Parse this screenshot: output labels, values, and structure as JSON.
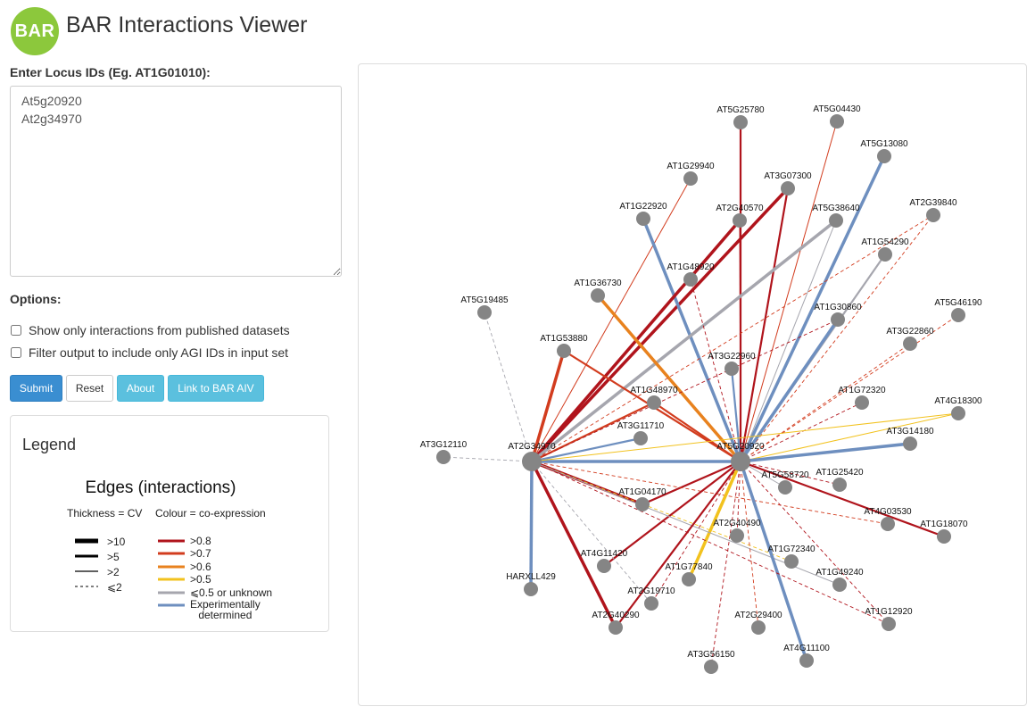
{
  "header": {
    "logo_text": "BAR",
    "title": "BAR Interactions Viewer"
  },
  "form": {
    "locus_label": "Enter Locus IDs (Eg. AT1G01010):",
    "locus_value": "At5g20920\nAt2g34970",
    "options_label": "Options:",
    "option_published": "Show only interactions from published datasets",
    "option_filter": "Filter output to include only AGI IDs in input set"
  },
  "buttons": {
    "submit": "Submit",
    "reset": "Reset",
    "about": "About",
    "link": "Link to BAR AIV"
  },
  "legend": {
    "title": "Legend",
    "edges_title": "Edges (interactions)",
    "thickness_header": "Thickness = CV",
    "colour_header": "Colour = co-expression",
    "thickness": [
      ">10",
      ">5",
      ">2",
      "⩽2"
    ],
    "colour": [
      {
        "label": ">0.8",
        "color": "#b0141c"
      },
      {
        "label": ">0.7",
        "color": "#d23c1e"
      },
      {
        "label": ">0.6",
        "color": "#e8821e"
      },
      {
        "label": ">0.5",
        "color": "#f2c21e"
      },
      {
        "label": "⩽0.5 or unknown",
        "color": "#a6a6ae"
      },
      {
        "label": "Experimentally\ndetermined",
        "color": "#6e8fbf"
      }
    ]
  },
  "graph": {
    "nodes": [
      {
        "id": "AT2G34970",
        "label": "AT2G34970",
        "hub": true
      },
      {
        "id": "AT5G20920",
        "label": "AT5G20920",
        "hub": true
      },
      {
        "id": "AT5G25780",
        "label": "AT5G25780"
      },
      {
        "id": "AT5G04430",
        "label": "AT5G04430"
      },
      {
        "id": "AT5G13080",
        "label": "AT5G13080"
      },
      {
        "id": "AT1G29940",
        "label": "AT1G29940"
      },
      {
        "id": "AT3G07300",
        "label": "AT3G07300"
      },
      {
        "id": "AT1G22920",
        "label": "AT1G22920"
      },
      {
        "id": "AT2G40570",
        "label": "AT2G40570"
      },
      {
        "id": "AT5G38640",
        "label": "AT5G38640"
      },
      {
        "id": "AT2G39840",
        "label": "AT2G39840"
      },
      {
        "id": "AT1G54290",
        "label": "AT1G54290"
      },
      {
        "id": "AT1G48920",
        "label": "AT1G48920"
      },
      {
        "id": "AT1G36730",
        "label": "AT1G36730"
      },
      {
        "id": "AT5G19485",
        "label": "AT5G19485"
      },
      {
        "id": "AT1G30860",
        "label": "AT1G30860"
      },
      {
        "id": "AT5G46190",
        "label": "AT5G46190"
      },
      {
        "id": "AT1G53880",
        "label": "AT1G53880"
      },
      {
        "id": "AT3G22860",
        "label": "AT3G22860"
      },
      {
        "id": "AT3G22960",
        "label": "AT3G22960"
      },
      {
        "id": "AT1G48970",
        "label": "AT1G48970"
      },
      {
        "id": "AT1G72320",
        "label": "AT1G72320"
      },
      {
        "id": "AT4G18300",
        "label": "AT4G18300"
      },
      {
        "id": "AT3G11710",
        "label": "AT3G11710"
      },
      {
        "id": "AT3G14180",
        "label": "AT3G14180"
      },
      {
        "id": "AT3G12110",
        "label": "AT3G12110"
      },
      {
        "id": "AT5G58720",
        "label": "AT5G58720"
      },
      {
        "id": "AT1G25420",
        "label": "AT1G25420"
      },
      {
        "id": "AT1G04170",
        "label": "AT1G04170"
      },
      {
        "id": "AT4G03530",
        "label": "AT4G03530"
      },
      {
        "id": "AT1G18070",
        "label": "AT1G18070"
      },
      {
        "id": "AT2G40490",
        "label": "AT2G40490"
      },
      {
        "id": "AT1G72340",
        "label": "AT1G72340"
      },
      {
        "id": "AT4G11420",
        "label": "AT4G11420"
      },
      {
        "id": "AT1G77840",
        "label": "AT1G77840"
      },
      {
        "id": "AT1G49240",
        "label": "AT1G49240"
      },
      {
        "id": "HARXLL429",
        "label": "HARXLL429"
      },
      {
        "id": "AT2G19710",
        "label": "AT2G19710"
      },
      {
        "id": "AT2G40290",
        "label": "AT2G40290"
      },
      {
        "id": "AT1G12920",
        "label": "AT1G12920"
      },
      {
        "id": "AT2G29400",
        "label": "AT2G29400"
      },
      {
        "id": "AT4G11100",
        "label": "AT4G11100"
      },
      {
        "id": "AT3G56150",
        "label": "AT3G56150"
      }
    ],
    "edges": [
      {
        "s": "AT5G20920",
        "t": "AT5G25780",
        "c": "r",
        "w": "m"
      },
      {
        "s": "AT5G20920",
        "t": "AT5G04430",
        "c": "o",
        "w": "t"
      },
      {
        "s": "AT5G20920",
        "t": "AT5G13080",
        "c": "b",
        "w": "k"
      },
      {
        "s": "AT2G34970",
        "t": "AT1G29940",
        "c": "o",
        "w": "t"
      },
      {
        "s": "AT2G34970",
        "t": "AT3G07300",
        "c": "r",
        "w": "k"
      },
      {
        "s": "AT5G20920",
        "t": "AT3G07300",
        "c": "r",
        "w": "m"
      },
      {
        "s": "AT5G20920",
        "t": "AT1G22920",
        "c": "b",
        "w": "k"
      },
      {
        "s": "AT2G34970",
        "t": "AT2G40570",
        "c": "r",
        "w": "k"
      },
      {
        "s": "AT5G20920",
        "t": "AT2G40570",
        "c": "r",
        "w": "t"
      },
      {
        "s": "AT2G34970",
        "t": "AT5G38640",
        "c": "g",
        "w": "k"
      },
      {
        "s": "AT5G20920",
        "t": "AT5G38640",
        "c": "g",
        "w": "t"
      },
      {
        "s": "AT5G20920",
        "t": "AT2G39840",
        "c": "o",
        "w": "d"
      },
      {
        "s": "AT5G20920",
        "t": "AT1G54290",
        "c": "g",
        "w": "m"
      },
      {
        "s": "AT5G20920",
        "t": "AT1G48920",
        "c": "r",
        "w": "d"
      },
      {
        "s": "AT5G20920",
        "t": "AT1G36730",
        "c": "y",
        "w": "k"
      },
      {
        "s": "AT2G34970",
        "t": "AT5G19485",
        "c": "g",
        "w": "d"
      },
      {
        "s": "AT5G20920",
        "t": "AT1G30860",
        "c": "b",
        "w": "k"
      },
      {
        "s": "AT5G20920",
        "t": "AT5G46190",
        "c": "o",
        "w": "d"
      },
      {
        "s": "AT2G34970",
        "t": "AT1G53880",
        "c": "o",
        "w": "k"
      },
      {
        "s": "AT5G20920",
        "t": "AT1G53880",
        "c": "o",
        "w": "m"
      },
      {
        "s": "AT5G20920",
        "t": "AT3G22860",
        "c": "o",
        "w": "d"
      },
      {
        "s": "AT5G20920",
        "t": "AT3G22960",
        "c": "b",
        "w": "m"
      },
      {
        "s": "AT2G34970",
        "t": "AT1G48970",
        "c": "o",
        "w": "m"
      },
      {
        "s": "AT5G20920",
        "t": "AT1G48970",
        "c": "o",
        "w": "m"
      },
      {
        "s": "AT5G20920",
        "t": "AT1G72320",
        "c": "r",
        "w": "d"
      },
      {
        "s": "AT5G20920",
        "t": "AT4G18300",
        "c": "y",
        "w": "t"
      },
      {
        "s": "AT2G34970",
        "t": "AT3G11710",
        "c": "b",
        "w": "m"
      },
      {
        "s": "AT5G20920",
        "t": "AT3G14180",
        "c": "b",
        "w": "k"
      },
      {
        "s": "AT2G34970",
        "t": "AT3G12110",
        "c": "g",
        "w": "d"
      },
      {
        "s": "AT2G34970",
        "t": "AT5G20920",
        "c": "b",
        "w": "k"
      },
      {
        "s": "AT5G20920",
        "t": "AT5G58720",
        "c": "g",
        "w": "t"
      },
      {
        "s": "AT5G20920",
        "t": "AT1G25420",
        "c": "r",
        "w": "d"
      },
      {
        "s": "AT2G34970",
        "t": "AT1G04170",
        "c": "r",
        "w": "k"
      },
      {
        "s": "AT5G20920",
        "t": "AT1G04170",
        "c": "r",
        "w": "m"
      },
      {
        "s": "AT2G34970",
        "t": "AT4G03530",
        "c": "o",
        "w": "d"
      },
      {
        "s": "AT5G20920",
        "t": "AT1G18070",
        "c": "r",
        "w": "m"
      },
      {
        "s": "AT5G20920",
        "t": "AT2G40490",
        "c": "r",
        "w": "d"
      },
      {
        "s": "AT2G34970",
        "t": "AT1G72340",
        "c": "y",
        "w": "d"
      },
      {
        "s": "AT5G20920",
        "t": "AT4G11420",
        "c": "r",
        "w": "m"
      },
      {
        "s": "AT5G20920",
        "t": "AT1G77840",
        "c": "y",
        "w": "k"
      },
      {
        "s": "AT2G34970",
        "t": "AT1G49240",
        "c": "g",
        "w": "t"
      },
      {
        "s": "AT2G34970",
        "t": "HARXLL429",
        "c": "b",
        "w": "k"
      },
      {
        "s": "AT2G34970",
        "t": "AT2G19710",
        "c": "g",
        "w": "d"
      },
      {
        "s": "AT5G20920",
        "t": "AT2G19710",
        "c": "r",
        "w": "d"
      },
      {
        "s": "AT2G34970",
        "t": "AT2G40290",
        "c": "r",
        "w": "k"
      },
      {
        "s": "AT5G20920",
        "t": "AT2G40290",
        "c": "r",
        "w": "m"
      },
      {
        "s": "AT5G20920",
        "t": "AT1G12920",
        "c": "r",
        "w": "d"
      },
      {
        "s": "AT5G20920",
        "t": "AT2G29400",
        "c": "o",
        "w": "d"
      },
      {
        "s": "AT5G20920",
        "t": "AT4G11100",
        "c": "b",
        "w": "k"
      },
      {
        "s": "AT5G20920",
        "t": "AT3G56150",
        "c": "r",
        "w": "d"
      },
      {
        "s": "AT2G34970",
        "t": "AT1G30860",
        "c": "r",
        "w": "d"
      },
      {
        "s": "AT2G34970",
        "t": "AT4G18300",
        "c": "y",
        "w": "t"
      },
      {
        "s": "AT2G34970",
        "t": "AT2G39840",
        "c": "o",
        "w": "d"
      },
      {
        "s": "AT2G34970",
        "t": "AT1G12920",
        "c": "r",
        "w": "d"
      }
    ]
  }
}
